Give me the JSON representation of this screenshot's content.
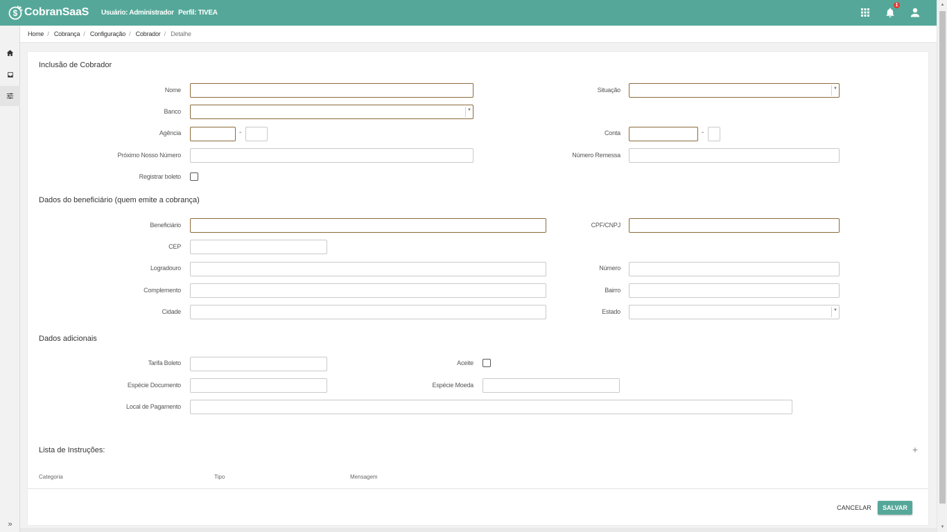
{
  "colors": {
    "brand": "#55a899",
    "required_border": "#8a6a3a",
    "badge": "#e53935"
  },
  "header": {
    "app_name": "CobranSaaS",
    "user_label": "Usuário: Administrador",
    "profile_label": "Perfil: TIVEA",
    "notification_count": "1",
    "icons": [
      "apps-grid-icon",
      "bell-icon",
      "user-icon"
    ]
  },
  "sidebar": {
    "items": [
      {
        "icon": "home-icon"
      },
      {
        "icon": "inbox-icon"
      },
      {
        "icon": "settings-sliders-icon",
        "active": true
      }
    ],
    "expand": "»"
  },
  "breadcrumb": [
    "Home",
    "Cobrança",
    "Configuração",
    "Cobrador",
    "Detalhe"
  ],
  "sections": {
    "cobrador": "Inclusão de Cobrador",
    "beneficiario": "Dados do beneficiário (quem emite a cobrança)",
    "adicionais": "Dados adicionais",
    "instrucoes": "Lista de Instruções:"
  },
  "fields": {
    "nome": {
      "label": "Nome",
      "value": ""
    },
    "situacao": {
      "label": "Situação",
      "value": ""
    },
    "banco": {
      "label": "Banco",
      "value": ""
    },
    "agencia": {
      "label": "Agência",
      "value": "",
      "digit": ""
    },
    "conta": {
      "label": "Conta",
      "value": "",
      "digit": ""
    },
    "proximo_nosso_numero": {
      "label": "Próximo Nosso Número",
      "value": ""
    },
    "numero_remessa": {
      "label": "Número Remessa",
      "value": ""
    },
    "registrar_boleto": {
      "label": "Registrar boleto",
      "checked": false
    },
    "beneficiario": {
      "label": "Beneficiário",
      "value": ""
    },
    "cpf_cnpj": {
      "label": "CPF/CNPJ",
      "value": ""
    },
    "cep": {
      "label": "CEP",
      "value": ""
    },
    "logradouro": {
      "label": "Logradouro",
      "value": ""
    },
    "numero": {
      "label": "Número",
      "value": ""
    },
    "complemento": {
      "label": "Complemento",
      "value": ""
    },
    "bairro": {
      "label": "Bairro",
      "value": ""
    },
    "cidade": {
      "label": "Cidade",
      "value": ""
    },
    "estado": {
      "label": "Estado",
      "value": ""
    },
    "tarifa_boleto": {
      "label": "Tarifa Boleto",
      "value": ""
    },
    "aceite": {
      "label": "Aceite",
      "checked": false
    },
    "especie_documento": {
      "label": "Espécie Documento",
      "value": ""
    },
    "especie_moeda": {
      "label": "Espécie Moeda",
      "value": ""
    },
    "local_pagamento": {
      "label": "Local de Pagamento",
      "value": ""
    }
  },
  "instructions_table": {
    "columns": [
      "Categoria",
      "Tipo",
      "Mensagem"
    ],
    "rows": [],
    "add_label": "+"
  },
  "actions": {
    "cancel": "CANCELAR",
    "save": "SALVAR"
  },
  "agencia_separator": "-",
  "conta_separator": "-"
}
